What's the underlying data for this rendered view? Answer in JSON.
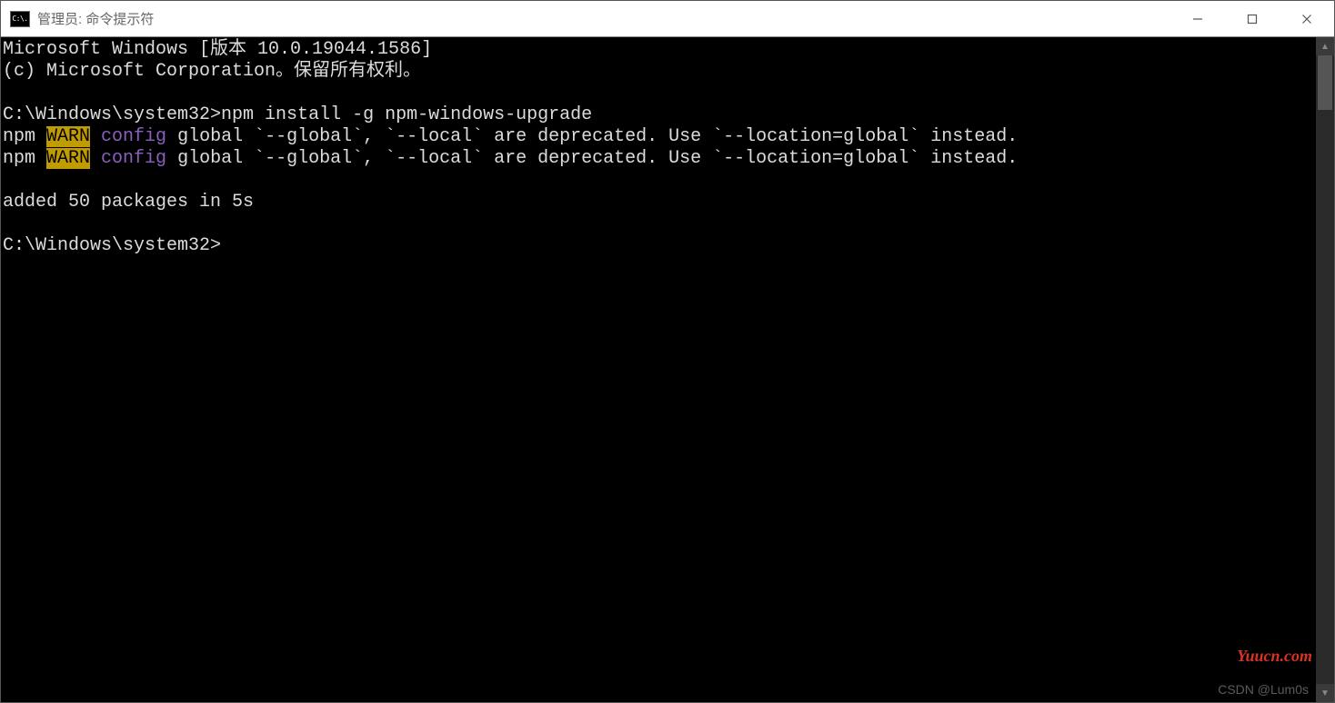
{
  "window": {
    "icon_label": "C:\\.",
    "title": "管理员: 命令提示符"
  },
  "terminal": {
    "line_version": "Microsoft Windows [版本 10.0.19044.1586]",
    "line_copyright": "(c) Microsoft Corporation。保留所有权利。",
    "prompt1": "C:\\Windows\\system32>",
    "command1": "npm install -g npm-windows-upgrade",
    "warn_prefix": "npm ",
    "warn_tag": "WARN",
    "warn_space": " ",
    "warn_config": "config",
    "warn_rest": " global `--global`, `--local` are deprecated. Use `--location=global` instead.",
    "added_line": "added 50 packages in 5s",
    "prompt2": "C:\\Windows\\system32>"
  },
  "watermarks": {
    "csdn": "CSDN @Lum0s",
    "yuucn": "Yuucn.com"
  }
}
